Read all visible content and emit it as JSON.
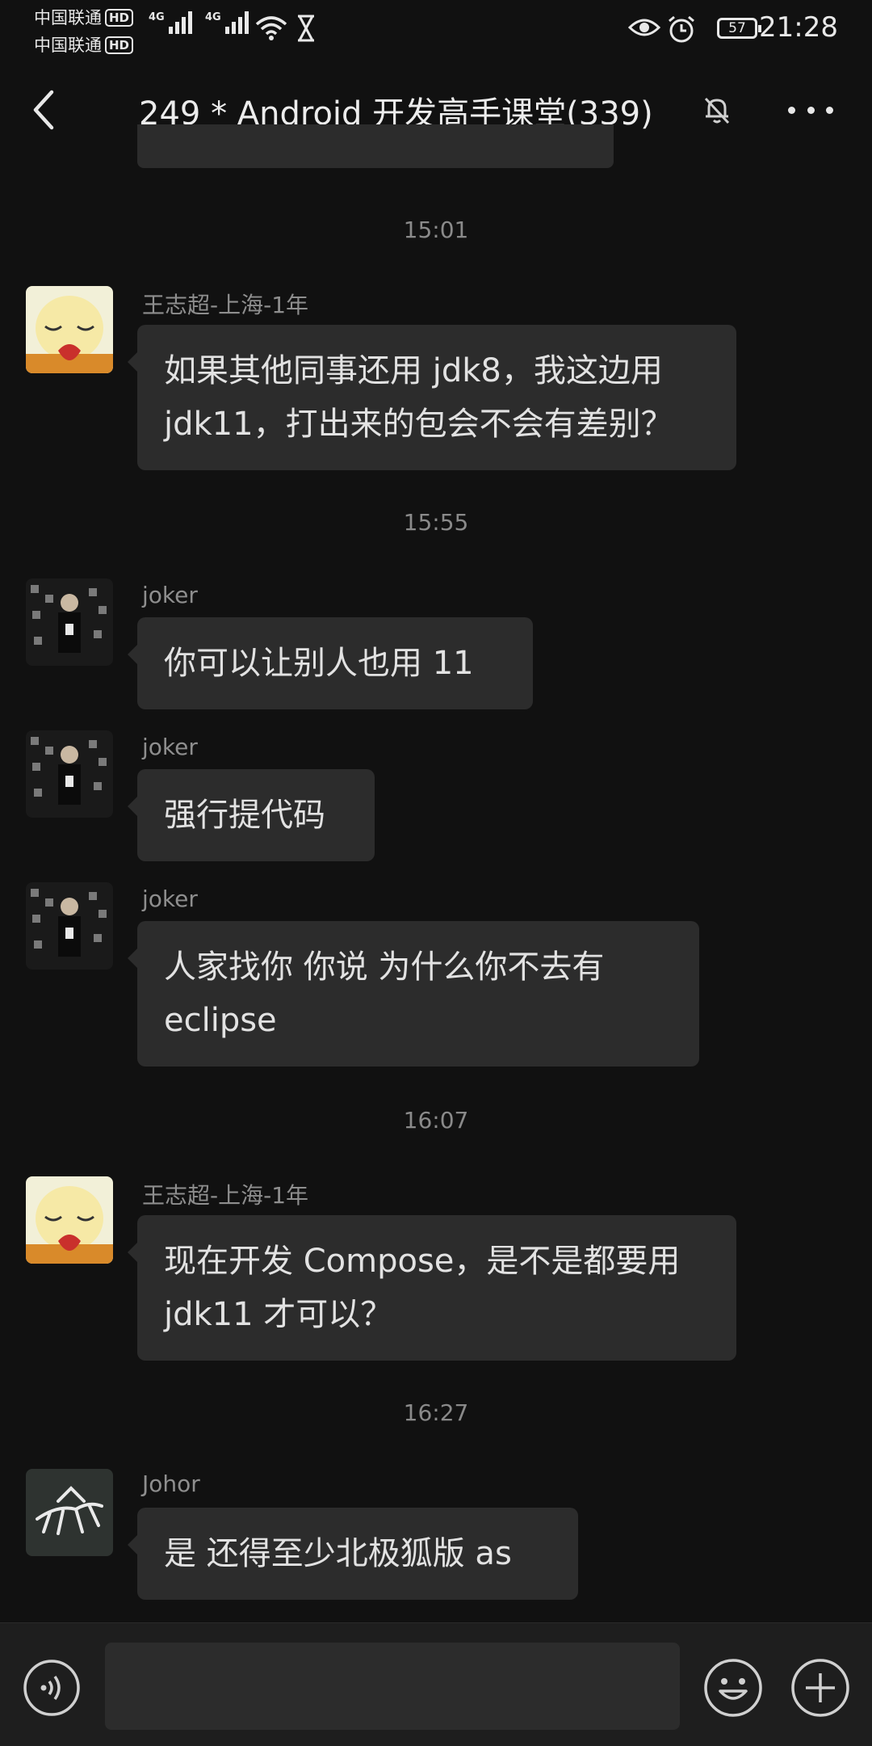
{
  "status_bar": {
    "carrier1": "中国联通",
    "carrier2": "中国联通",
    "hd_badge": "HD",
    "network1": "4G",
    "network2": "4G",
    "battery": "57",
    "time": "21:28"
  },
  "header": {
    "title": "249 * Android 开发高手课堂(339)"
  },
  "messages": [
    {
      "type": "timestamp",
      "text": "15:01"
    },
    {
      "type": "message",
      "sender": "王志超-上海-1年",
      "text": "如果其他同事还用 jdk8，我这边用 jdk11，打出来的包会不会有差别？"
    },
    {
      "type": "timestamp",
      "text": "15:55"
    },
    {
      "type": "message",
      "sender": "joker",
      "text": "你可以让别人也用 11"
    },
    {
      "type": "message",
      "sender": "joker",
      "text": "强行提代码"
    },
    {
      "type": "message",
      "sender": "joker",
      "text": "人家找你 你说  为什么你不去有 eclipse"
    },
    {
      "type": "timestamp",
      "text": "16:07"
    },
    {
      "type": "message",
      "sender": "王志超-上海-1年",
      "text": "现在开发 Compose，是不是都要用 jdk11 才可以？"
    },
    {
      "type": "timestamp",
      "text": "16:27"
    },
    {
      "type": "message",
      "sender": "Johor",
      "text": "是 还得至少北极狐版 as"
    }
  ],
  "icons": {
    "back": "chevron-left-icon",
    "mute": "bell-off-icon",
    "more": "more-icon",
    "voice": "voice-icon",
    "emoji": "emoji-icon",
    "plus": "plus-icon"
  }
}
